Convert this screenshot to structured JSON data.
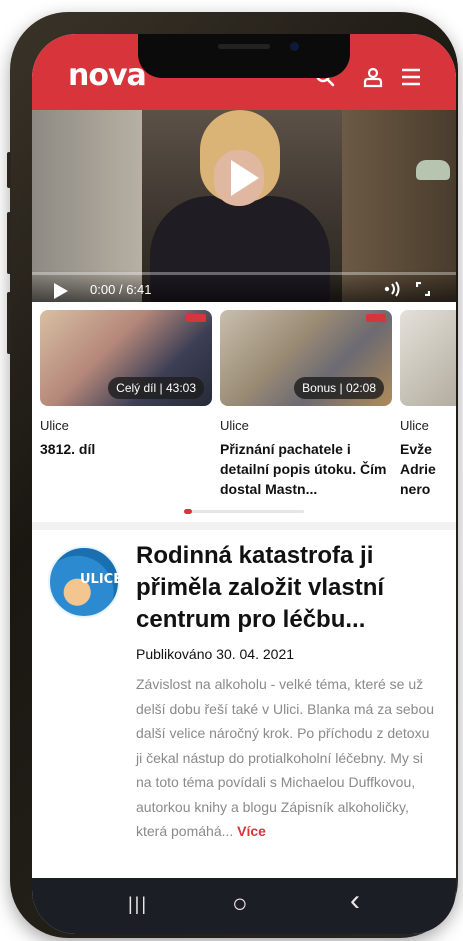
{
  "header": {
    "logo": "nova",
    "icons": [
      "search-icon",
      "user-icon",
      "menu-icon"
    ],
    "accent": "#d8343c"
  },
  "video": {
    "current_time": "0:00",
    "separator": "/",
    "duration": "6:41",
    "progress": 0
  },
  "carousel": {
    "items": [
      {
        "show": "Ulice",
        "title": "3812. díl",
        "badge": "Celý díl | 43:03"
      },
      {
        "show": "Ulice",
        "title": "Přiznání pachatele i detailní popis útoku. Čím dostal Mastn...",
        "badge": "Bonus | 02:08"
      },
      {
        "show": "Ulice",
        "title": "Evže Adrie nero",
        "badge": ""
      }
    ],
    "active_index": 0
  },
  "article": {
    "avatar_label": "ULICE",
    "title": "Rodinná katastrofa ji přiměla založit vlastní centrum pro léčbu...",
    "date": "Publikováno 30. 04. 2021",
    "body": "Závislost na alkoholu - velké téma, které se už delší dobu řeší také v Ulici. Blanka má za sebou další velice náročný krok. Po příchodu z detoxu ji čekal nástup do protialkoholní léčebny. My si na toto téma povídali s Michaelou Duffkovou, autorkou knihy a blogu Zápisník alkoholičky, která pomáhá...",
    "more_label": "Více"
  },
  "navbar": {
    "recents": "|||",
    "home": "○",
    "back": "‹"
  }
}
